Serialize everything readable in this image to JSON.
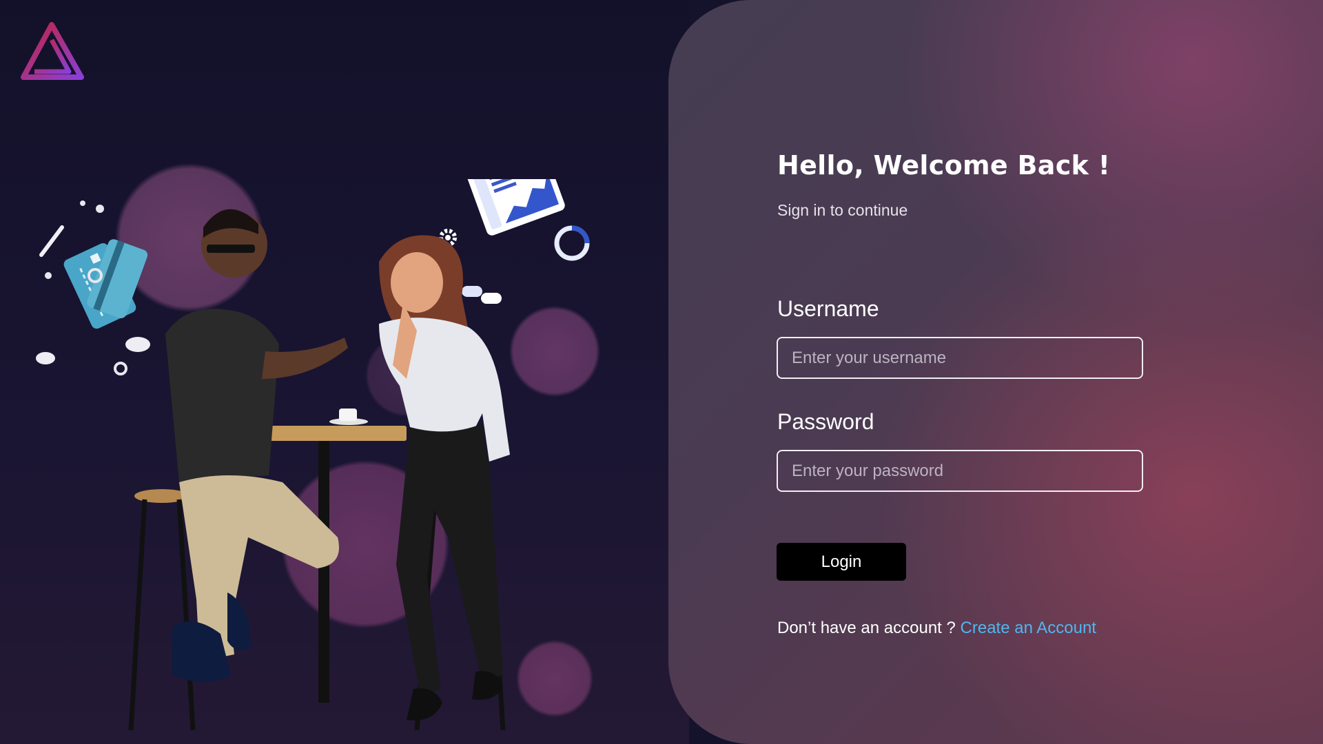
{
  "brand": {
    "logo_icon": "triangle-logo-icon",
    "gradient_colors": [
      "#c2243f",
      "#8a3fd8"
    ]
  },
  "login": {
    "title": "Hello, Welcome Back !",
    "subtitle": "Sign in to continue",
    "username_label": "Username",
    "username_placeholder": "Enter your username",
    "username_value": "",
    "password_label": "Password",
    "password_placeholder": "Enter your password",
    "password_value": "",
    "login_button": "Login",
    "signup_prompt": "Don’t have an account ?",
    "signup_link": "Create an Account"
  },
  "colors": {
    "background_dark": "#15122b",
    "panel": "#4b3b52",
    "link": "#4fb7f0",
    "button": "#000000"
  }
}
